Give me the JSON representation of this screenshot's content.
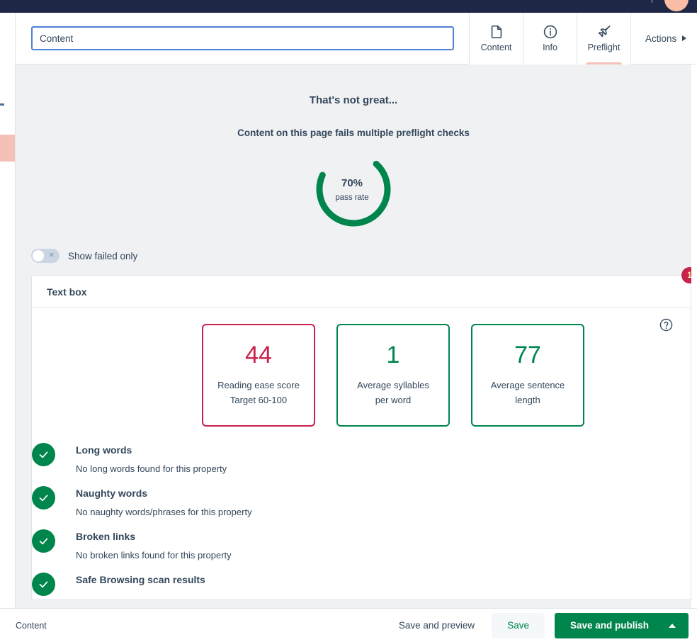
{
  "header": {
    "avatar_name": "user-avatar"
  },
  "toolbar": {
    "title_value": "Content",
    "title_placeholder": "Content",
    "tabs": [
      {
        "label": "Content",
        "icon": "document-icon",
        "active": false
      },
      {
        "label": "Info",
        "icon": "info-icon",
        "active": false
      },
      {
        "label": "Preflight",
        "icon": "airplane-icon",
        "active": true
      }
    ],
    "actions_label": "Actions"
  },
  "preflight": {
    "headline": "That's not great...",
    "subhead": "Content on this page fails multiple preflight checks",
    "pass_rate_value": "70%",
    "pass_rate_label": "pass rate",
    "pass_rate_percent": 70,
    "donut_color": "#00854d",
    "toggle_label": "Show failed only",
    "toggle_state": "off"
  },
  "card": {
    "title": "Text box",
    "badge_count": "1",
    "help_icon": "question-circle-icon",
    "metrics": [
      {
        "value": "44",
        "line1": "Reading ease score",
        "line2": "Target 60-100",
        "status": "fail",
        "color": "#c8214b"
      },
      {
        "value": "1",
        "line1": "Average syllables",
        "line2": "per word",
        "status": "pass",
        "color": "#00854d"
      },
      {
        "value": "77",
        "line1": "Average sentence",
        "line2": "length",
        "status": "pass",
        "color": "#00854d"
      }
    ],
    "checks": [
      {
        "title": "Long words",
        "description": "No long words found for this property",
        "status": "pass"
      },
      {
        "title": "Naughty words",
        "description": "No naughty words/phrases for this property",
        "status": "pass"
      },
      {
        "title": "Broken links",
        "description": "No broken links found for this property",
        "status": "pass"
      },
      {
        "title": "Safe Browsing scan results",
        "description": "",
        "status": "pass"
      }
    ]
  },
  "bottom_bar": {
    "label": "Content",
    "save_preview_label": "Save and preview",
    "save_label": "Save",
    "save_publish_label": "Save and publish"
  }
}
